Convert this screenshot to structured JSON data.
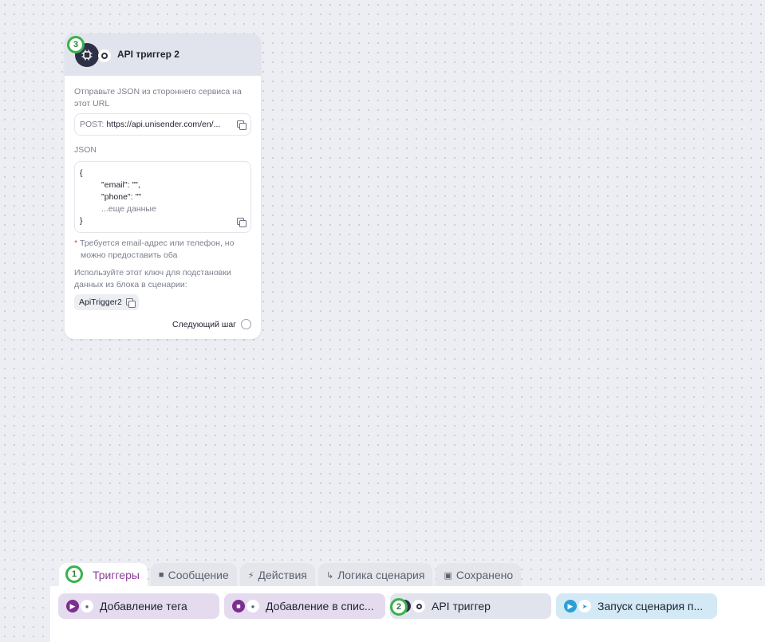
{
  "node": {
    "title": "API триггер 2",
    "description": "Отправьте JSON из стороннего сервиса на этот URL",
    "url_method": "POST:",
    "url": "https://api.unisender.com/en/...",
    "json_label": "JSON",
    "json_lines": [
      "{",
      "\"email\": \"\",",
      "\"phone\": \"\"",
      "...еще данные",
      "}"
    ],
    "note_star": "*",
    "note_line1": "Требуется email-адрес или телефон, но",
    "note_line2": "можно предоставить оба",
    "key_desc": "Используйте этот ключ для подстановки данных из блока в сценарии:",
    "key": "ApiTrigger2",
    "next_step": "Следующий шаг"
  },
  "markers": [
    "1",
    "2",
    "3"
  ],
  "tabs": [
    {
      "label": "Триггеры",
      "icon": "lightning-icon"
    },
    {
      "label": "Сообщение",
      "icon": "chat-icon"
    },
    {
      "label": "Действия",
      "icon": "bolt-icon"
    },
    {
      "label": "Логика сценария",
      "icon": "branch-icon"
    },
    {
      "label": "Сохранено",
      "icon": "save-icon"
    }
  ],
  "chips": [
    {
      "label": "Добавление тега",
      "icon": "tag-icon"
    },
    {
      "label": "Добавление в спис...",
      "icon": "list-icon"
    },
    {
      "label": "API триггер",
      "icon": "api-icon"
    },
    {
      "label": "Запуск сценария п...",
      "icon": "telegram-icon"
    }
  ],
  "colors": {
    "marker": "#38b24b",
    "active_tab": "#8a3b9a",
    "purple_chip": "#e5dbef",
    "api_chip": "#e1e4ec",
    "telegram_chip": "#d3e9f5"
  }
}
